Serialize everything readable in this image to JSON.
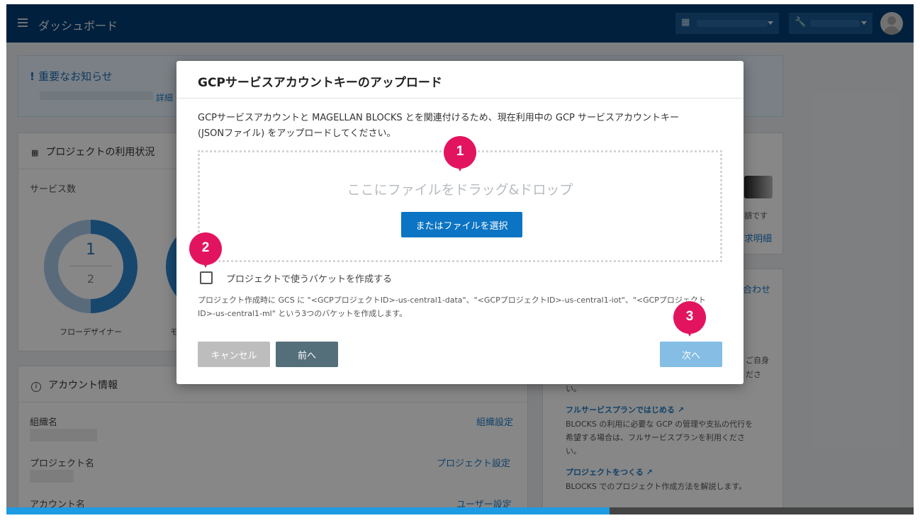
{
  "header": {
    "title": "ダッシュボード"
  },
  "notice": {
    "title": "重要なお知らせ",
    "detail_link": "詳細"
  },
  "project_usage": {
    "title": "プロジェクトの利用状況",
    "service_count_label": "サービス数",
    "flow_designer": {
      "used": "1",
      "total": "2",
      "label": "フローデザイナー"
    },
    "second_label": "モ"
  },
  "billing_card": {
    "amount_suffix": "額です",
    "invoice_link": "求明細"
  },
  "contact_card": {
    "title_link": "合わせ",
    "text_1": "ご自身",
    "text_2": "ださ",
    "text_3": "い。",
    "full_service_link": "フルサービスプランではじめる",
    "full_service_desc_1": "BLOCKS の利用に必要な GCP の管理や支払の代行を",
    "full_service_desc_2": "希望する場合は、フルサービスプランを利用くださ",
    "full_service_desc_3": "い。",
    "create_project_link": "プロジェクトをつくる",
    "create_project_desc": "BLOCKS でのプロジェクト作成方法を解説します。"
  },
  "account_card": {
    "title": "アカウント情報",
    "org_label": "組織名",
    "org_link": "組織設定",
    "project_label": "プロジェクト名",
    "project_link": "プロジェクト設定",
    "account_label": "アカウント名",
    "account_link": "ユーザー設定"
  },
  "progress": {
    "fraction": 0.665
  },
  "modal": {
    "title": "GCPサービスアカウントキーのアップロード",
    "description_1": "GCPサービスアカウントと MAGELLAN BLOCKS とを関連付けるため、現在利用中の GCP サービスアカウントキー",
    "description_2": "(JSONファイル) をアップロードしてください。",
    "drop_text": "ここにファイルをドラッグ&ドロップ",
    "choose_button": "またはファイルを選択",
    "checkbox_label": "プロジェクトで使うバケットを作成する",
    "checkbox_checked": false,
    "note_1": "プロジェクト作成時に GCS に \"<GCPプロジェクトID>-us-central1-data\"、\"<GCPプロジェクトID>-us-central1-iot\"、\"<GCPプロジェクト",
    "note_2": "ID>-us-central1-ml\" という3つのバケットを作成します。",
    "cancel_button": "キャンセル",
    "back_button": "前へ",
    "next_button": "次へ"
  },
  "callouts": [
    "1",
    "2",
    "3"
  ],
  "colors": {
    "header": "#003e74",
    "primary_button": "#0b74c4",
    "callout": "#e3145f",
    "progress": "#1e9be3"
  }
}
